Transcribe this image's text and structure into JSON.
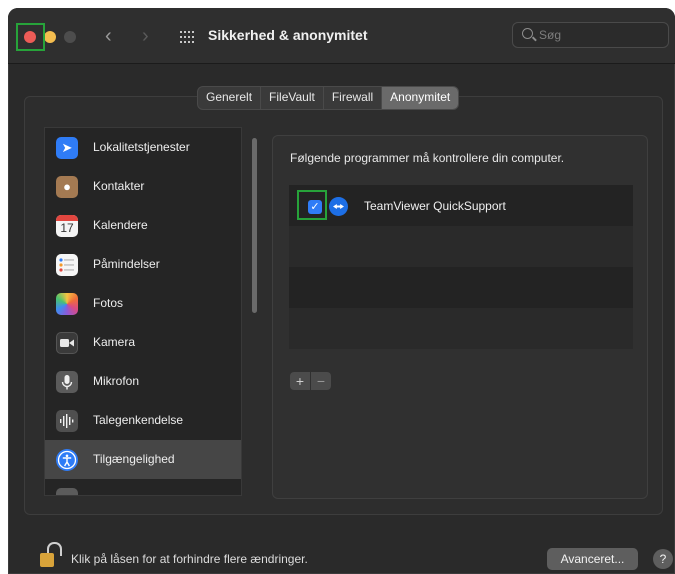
{
  "window": {
    "title": "Sikkerhed & anonymitet",
    "search_placeholder": "Søg"
  },
  "tabs": [
    {
      "label": "Generelt",
      "active": false
    },
    {
      "label": "FileVault",
      "active": false
    },
    {
      "label": "Firewall",
      "active": false
    },
    {
      "label": "Anonymitet",
      "active": true
    }
  ],
  "sidebar": {
    "items": [
      {
        "label": "Lokalitetstjenester",
        "icon": "location-arrow-icon",
        "selected": false
      },
      {
        "label": "Kontakter",
        "icon": "contacts-icon",
        "selected": false
      },
      {
        "label": "Kalendere",
        "icon": "calendar-icon",
        "selected": false,
        "icon_text": "17"
      },
      {
        "label": "Påmindelser",
        "icon": "reminders-icon",
        "selected": false
      },
      {
        "label": "Fotos",
        "icon": "photos-icon",
        "selected": false
      },
      {
        "label": "Kamera",
        "icon": "camera-icon",
        "selected": false
      },
      {
        "label": "Mikrofon",
        "icon": "microphone-icon",
        "selected": false
      },
      {
        "label": "Talegenkendelse",
        "icon": "speech-recognition-icon",
        "selected": false
      },
      {
        "label": "Tilgængelighed",
        "icon": "accessibility-icon",
        "selected": true
      }
    ]
  },
  "main": {
    "description": "Følgende programmer må kontrollere din computer.",
    "apps": [
      {
        "name": "TeamViewer QuickSupport",
        "checked": true,
        "icon": "teamviewer-icon"
      }
    ],
    "add_label": "+",
    "remove_label": "−"
  },
  "footer": {
    "lock_text": "Klik på låsen for at forhindre flere ændringer.",
    "advanced_label": "Avanceret...",
    "help_label": "?"
  },
  "colors": {
    "accent": "#2f7cf6",
    "highlight": "#27a33a",
    "close": "#ed5c57",
    "minimize": "#f4bd4f"
  }
}
